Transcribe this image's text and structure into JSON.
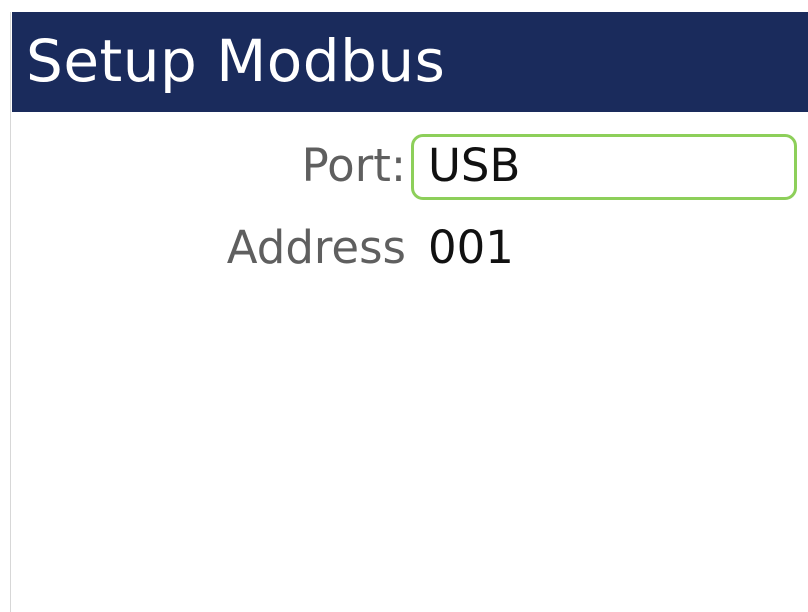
{
  "header": {
    "title": "Setup Modbus"
  },
  "form": {
    "port": {
      "label": "Port:",
      "value": "USB"
    },
    "address": {
      "label": "Address",
      "value": "001"
    }
  },
  "colors": {
    "header_background": "#1a2b5c",
    "header_text": "#ffffff",
    "label_text": "#5f5f5f",
    "value_text": "#111111",
    "focus_border": "#8dcf5a"
  }
}
